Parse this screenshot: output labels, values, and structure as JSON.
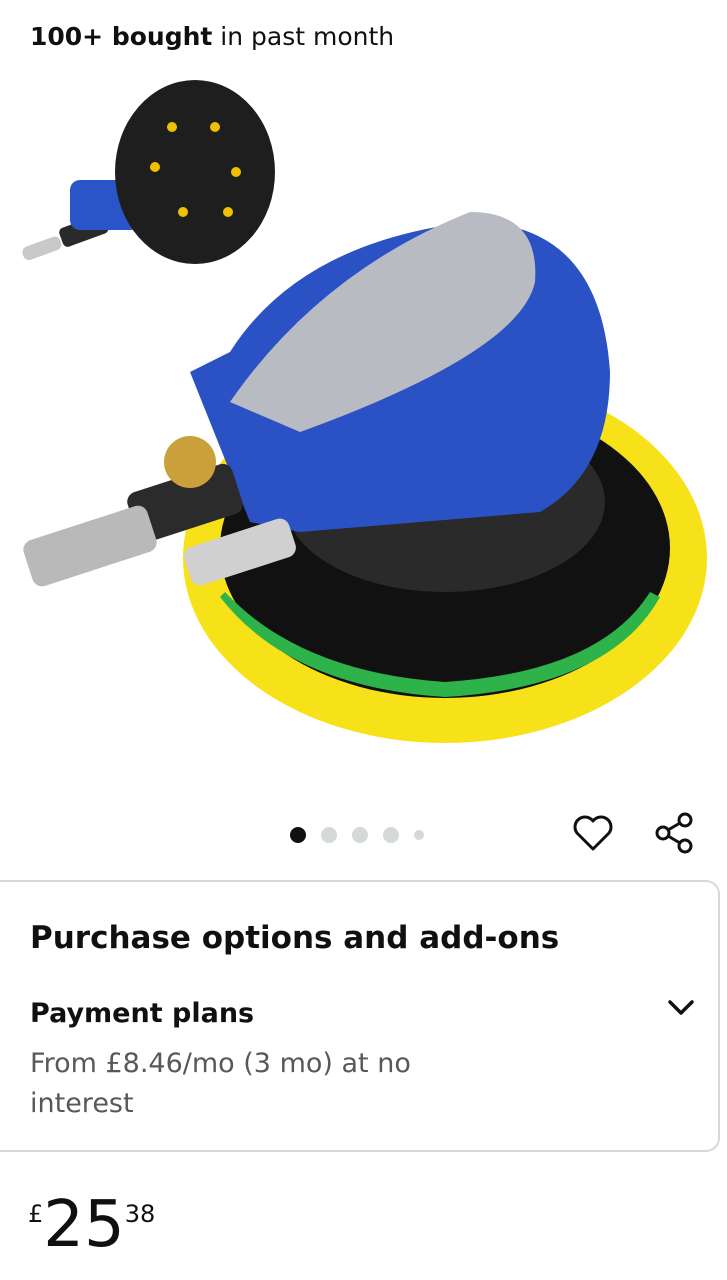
{
  "social_proof": {
    "bold": "100+ bought",
    "rest": " in past month"
  },
  "gallery": {
    "images": [
      "product-main",
      "product-2",
      "product-3",
      "product-4",
      "product-5"
    ],
    "active_index": 0
  },
  "actions": {
    "heart_icon": "heart-icon",
    "share_icon": "share-icon"
  },
  "purchase_options": {
    "title": "Purchase options and add-ons",
    "payment_plans_label": "Payment plans",
    "payment_plans_text": "From £8.46/mo (3 mo) at no interest",
    "expand_icon": "chevron-down-icon"
  },
  "price": {
    "symbol": "£",
    "whole": "25",
    "fraction": "38"
  }
}
